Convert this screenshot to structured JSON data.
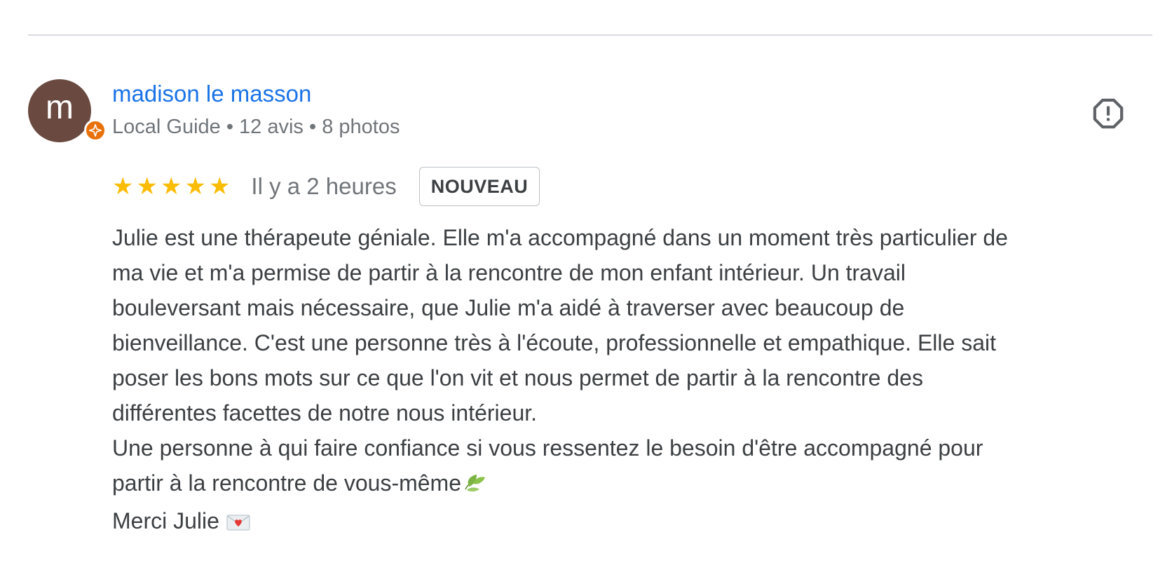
{
  "author": {
    "avatar_letter": "m",
    "name": "madison le masson",
    "meta": "Local Guide • 12 avis • 8 photos"
  },
  "review": {
    "rating": 5,
    "max_rating": 5,
    "time": "Il y a 2 heures",
    "badge": "NOUVEAU",
    "lines": [
      "Julie est une thérapeute géniale. Elle m'a accompagné dans un moment très particulier de",
      "ma vie et m'a permise de partir à la rencontre de mon enfant intérieur. Un travail",
      "bouleversant mais nécessaire, que Julie m'a aidé à traverser avec beaucoup de",
      "bienveillance. C'est une personne très à l'écoute, professionnelle et empathique. Elle sait",
      "poser les bons mots sur ce que l'on vit et nous permet de partir à la rencontre des",
      "différentes facettes de notre nous intérieur.",
      "Une personne à qui faire confiance si vous ressentez le besoin d'être accompagné pour",
      "partir à la rencontre de vous-même",
      "Merci Julie"
    ]
  },
  "icons": {
    "avatar_badge": "local-guide-badge-icon",
    "flag": "report-flag-icon",
    "leaves": "leaves-emoji-icon",
    "love_letter": "love-letter-emoji-icon"
  },
  "colors": {
    "name_link": "#1a73e8",
    "star": "#fbbc04",
    "avatar_bg": "#6a4a40",
    "guide_badge": "#e8710a"
  }
}
